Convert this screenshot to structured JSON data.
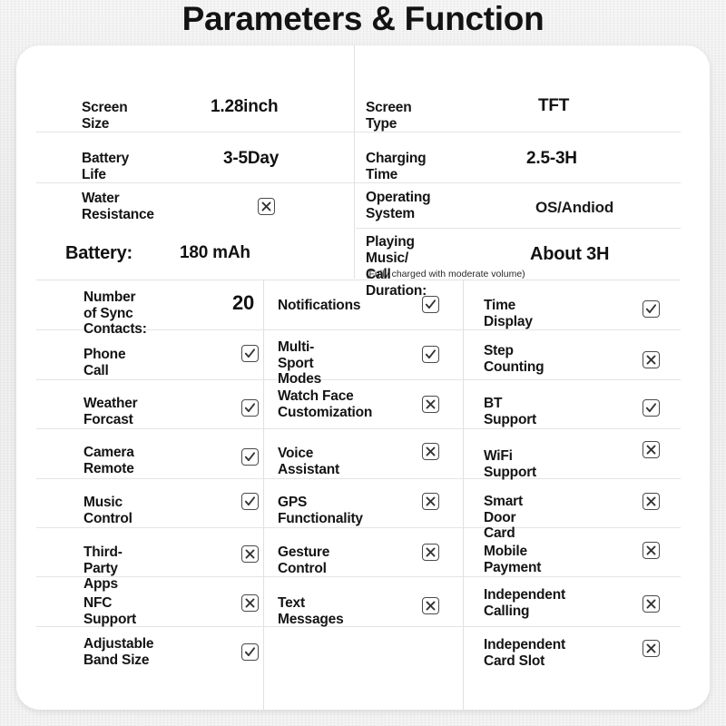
{
  "title": "Parameters & Function",
  "specs_two_col": {
    "rows": [
      {
        "left": {
          "label": "Screen Size",
          "value": "1.28inch",
          "value_style": "bold"
        },
        "right": {
          "label": "Screen Type",
          "value": "TFT",
          "value_style": "bold"
        }
      },
      {
        "left": {
          "label": "Battery Life",
          "value": "3-5Day",
          "value_style": "bold"
        },
        "right": {
          "label": "Charging Time",
          "value": "2.5-3H",
          "value_style": "bold"
        }
      },
      {
        "left": {
          "label": "Water Resistance",
          "label_line1": "Water",
          "label_line2": "Resistance",
          "mark": "cross"
        },
        "right": {
          "label": "Operating System",
          "label_line1": "Operating",
          "label_line2": "System",
          "value": "OS/Andiod",
          "value_style": "light"
        }
      },
      {
        "left": {
          "label": "Battery:",
          "value": "180 mAh",
          "value_style": "bold"
        },
        "right": {
          "label_line1": "Playing Music/",
          "label_line2": "Call Duration:",
          "note": "(Fully charged with moderate volume)",
          "value": "About 3H",
          "value_style": "bold"
        }
      }
    ]
  },
  "features_three_col": {
    "columns": [
      {
        "items": [
          {
            "label_line1": "Number of Sync",
            "label_line2": "Contacts:",
            "value": "20",
            "mark": "value"
          },
          {
            "label_line1": "Phone Call",
            "mark": "check"
          },
          {
            "label_line1": "Weather Forcast",
            "mark": "check"
          },
          {
            "label_line1": "Camera Remote",
            "mark": "check"
          },
          {
            "label_line1": "Music Control",
            "mark": "check"
          },
          {
            "label_line1": "Third-Party Apps",
            "mark": "cross"
          },
          {
            "label_line1": "NFC Support",
            "mark": "cross"
          },
          {
            "label_line1": "Adjustable",
            "label_line2": "Band Size",
            "mark": "check"
          }
        ]
      },
      {
        "items": [
          {
            "label_line1": "Notifications",
            "mark": "check"
          },
          {
            "label_line1": "Multi-Sport",
            "label_line2": "Modes",
            "mark": "check"
          },
          {
            "label_line1": "Watch Face",
            "label_line2": "Customization",
            "mark": "cross"
          },
          {
            "label_line1": "Voice Assistant",
            "mark": "cross"
          },
          {
            "label_line1": "GPS Functionality",
            "mark": "cross"
          },
          {
            "label_line1": "Gesture Control",
            "mark": "cross"
          },
          {
            "label_line1": "Text Messages",
            "mark": "cross"
          },
          {
            "label_line1": "",
            "mark": "none"
          }
        ]
      },
      {
        "items": [
          {
            "label_line1": "Time Display",
            "mark": "check"
          },
          {
            "label_line1": "Step Counting",
            "mark": "cross"
          },
          {
            "label_line1": "BT Support",
            "mark": "check"
          },
          {
            "label_line1": "WiFi Support",
            "mark": "cross"
          },
          {
            "label_line1": "Smart Door Card",
            "mark": "cross"
          },
          {
            "label_line1": "Mobile Payment",
            "mark": "cross"
          },
          {
            "label_line1": "Independent",
            "label_line2": "Calling",
            "mark": "cross"
          },
          {
            "label_line1": "Independent",
            "label_line2": "Card Slot",
            "mark": "cross"
          }
        ]
      }
    ]
  },
  "icons": {
    "check": "checkbox-checked-icon",
    "cross": "checkbox-crossed-icon"
  },
  "colors": {
    "card": "#ffffff",
    "page": "#f2f2f2",
    "text": "#141414",
    "rule": "#e4e4e4",
    "box_border": "#4a4a4a"
  }
}
